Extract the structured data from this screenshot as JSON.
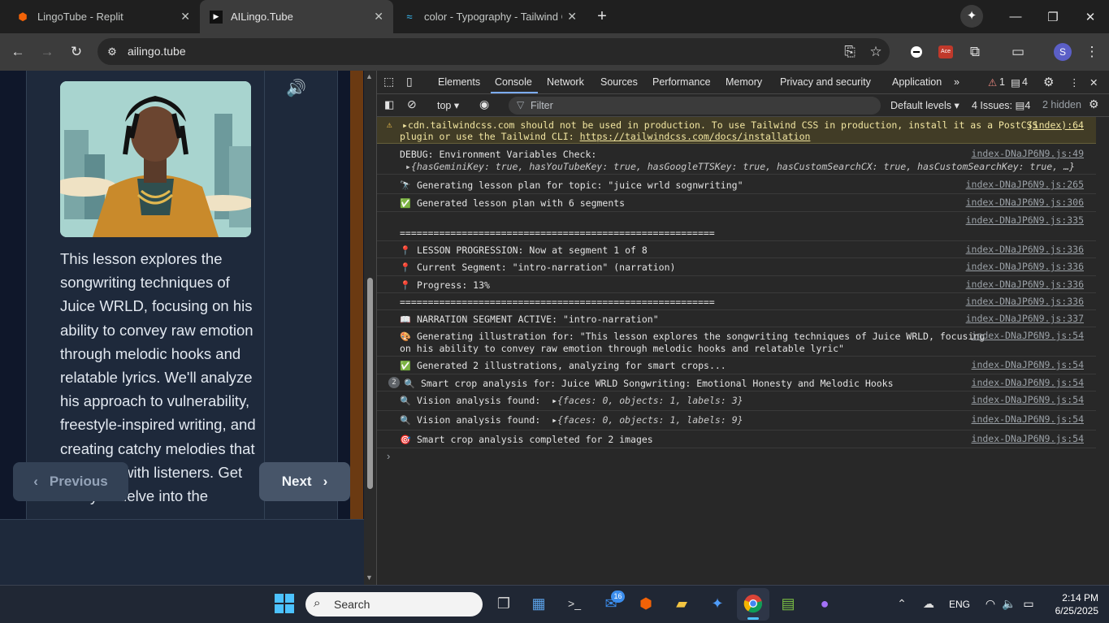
{
  "browser": {
    "tabs": [
      {
        "title": "LingoTube - Replit",
        "favicon": "replit-icon"
      },
      {
        "title": "AILingo.Tube",
        "favicon": "ailingo-icon",
        "active": true
      },
      {
        "title": "color - Typography - Tailwind C",
        "favicon": "tailwind-icon"
      }
    ],
    "url": "ailingo.tube",
    "profile_initial": "S"
  },
  "page": {
    "lesson_text": "This lesson explores the songwriting techniques of Juice WRLD, focusing on his ability to convey raw emotion through melodic hooks and relatable lyrics. We'll analyze his approach to vulnerability, freestyle-inspired writing, and creating catchy melodies that resonate with listeners. Get ready to delve into the",
    "prev_label": "Previous",
    "next_label": "Next"
  },
  "devtools": {
    "tabs": [
      "Elements",
      "Console",
      "Network",
      "Sources",
      "Performance",
      "Memory",
      "Privacy and security",
      "Application"
    ],
    "active_tab": "Console",
    "warn_count": "1",
    "msg_count": "4",
    "context": "top",
    "filter_placeholder": "Filter",
    "levels": "Default levels",
    "issues_label": "4 Issues:",
    "issues_count": "4",
    "hidden": "2 hidden",
    "messages": [
      {
        "icon": "warning-icon",
        "text": "cdn.tailwindcss.com should not be used in production. To use Tailwind CSS in production, install it as a PostCSS",
        "text2": "plugin or use the Tailwind CLI: ",
        "link": "https://tailwindcss.com/docs/installation",
        "src": "(index):64"
      },
      {
        "icon": "",
        "text": "DEBUG: Environment Variables Check:",
        "text2": "{hasGeminiKey: true, hasYouTubeKey: true, hasGoogleTTSKey: true, hasCustomSearchCX: true, hasCustomSearchKey: true, …}",
        "src": "index-DNaJP6N9.js:49"
      },
      {
        "icon": "🔭",
        "text": "Generating lesson plan for topic: \"juice wrld sognwriting\"",
        "src": "index-DNaJP6N9.js:265"
      },
      {
        "icon": "✅",
        "text": "Generated lesson plan with 6 segments",
        "src": "index-DNaJP6N9.js:306"
      },
      {
        "icon": "",
        "text": "",
        "text2": "========================================================",
        "src": "index-DNaJP6N9.js:335"
      },
      {
        "icon": "📍",
        "text": "LESSON PROGRESSION: Now at segment 1 of 8",
        "src": "index-DNaJP6N9.js:336"
      },
      {
        "icon": "📍",
        "text": "Current Segment: \"intro-narration\" (narration)",
        "src": "index-DNaJP6N9.js:336"
      },
      {
        "icon": "📍",
        "text": "Progress: 13%",
        "src": "index-DNaJP6N9.js:336"
      },
      {
        "icon": "",
        "text": "========================================================",
        "src": "index-DNaJP6N9.js:336"
      },
      {
        "icon": "📖",
        "text": "NARRATION SEGMENT ACTIVE: \"intro-narration\"",
        "src": "index-DNaJP6N9.js:337"
      },
      {
        "icon": "🎨",
        "text": "Generating illustration for: \"This lesson explores the songwriting techniques of Juice WRLD, focusing",
        "text2": "on his ability to convey raw emotion through melodic hooks and relatable lyric\"",
        "src": "index-DNaJP6N9.js:54"
      },
      {
        "icon": "✅",
        "text": "Generated 2 illustrations, analyzing for smart crops...",
        "src": "index-DNaJP6N9.js:54"
      },
      {
        "icon": "🔍",
        "badge": "2",
        "text": "Smart crop analysis for: Juice WRLD Songwriting: Emotional Honesty and Melodic Hooks",
        "src": "index-DNaJP6N9.js:54"
      },
      {
        "icon": "🔍",
        "text": "Vision analysis found:",
        "obj": "{faces: 0, objects: 1, labels: 3}",
        "src": "index-DNaJP6N9.js:54"
      },
      {
        "icon": "🔍",
        "text": "Vision analysis found:",
        "obj": "{faces: 0, objects: 1, labels: 9}",
        "src": "index-DNaJP6N9.js:54"
      },
      {
        "icon": "🎯",
        "text": "Smart crop analysis completed for 2 images",
        "src": "index-DNaJP6N9.js:54"
      }
    ]
  },
  "taskbar": {
    "search_placeholder": "Search",
    "mail_badge": "16",
    "lang": "ENG",
    "time": "2:14 PM",
    "date": "6/25/2025"
  }
}
